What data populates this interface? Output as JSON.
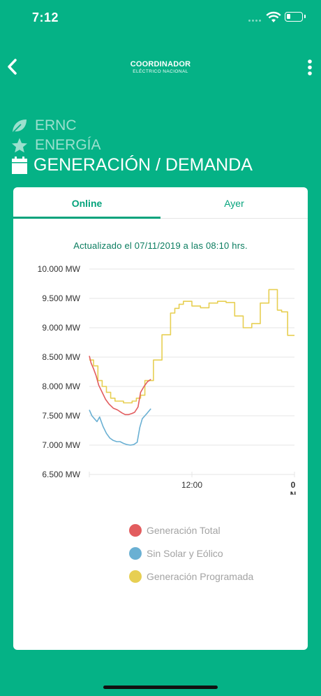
{
  "status_bar": {
    "time": "7:12"
  },
  "nav": {
    "logo_line1": "COORDINADOR",
    "logo_line2": "ELÉCTRICO NACIONAL"
  },
  "menu": [
    {
      "label": "ERNC",
      "icon": "leaf-icon"
    },
    {
      "label": "ENERGÍA",
      "icon": "star-icon"
    },
    {
      "label": "GENERACIÓN / DEMANDA",
      "icon": "calendar-icon"
    }
  ],
  "tabs": [
    {
      "label": "Online",
      "active": true
    },
    {
      "label": "Ayer",
      "active": false
    }
  ],
  "updated_text": "Actualizado el 07/11/2019 a las 08:10 hrs.",
  "colors": {
    "background": "#05b286",
    "accent": "#05a37c"
  },
  "chart_data": {
    "type": "line",
    "ylim": [
      6500,
      10000
    ],
    "y_ticks": [
      10000,
      9500,
      9000,
      8500,
      8000,
      7500,
      7000,
      6500
    ],
    "y_tick_labels": [
      "10.000 MW",
      "9.500 MW",
      "9.000 MW",
      "8.500 MW",
      "8.000 MW",
      "7.500 MW",
      "7.000 MW",
      "6.500 MW"
    ],
    "x_ticks": [
      {
        "hour": 12,
        "label": "12:00"
      },
      {
        "hour": 24,
        "label": "0"
      }
    ],
    "x_edge_label": "N",
    "xlim": [
      0,
      24
    ],
    "series": [
      {
        "name": "Generación Total",
        "color": "#e25c5e",
        "x": [
          0,
          0.2,
          0.5,
          0.8,
          1.1,
          1.5,
          1.9,
          2.3,
          2.8,
          3.3,
          3.8,
          4.2,
          4.6,
          5.0,
          5.3,
          5.7,
          6.0,
          6.4,
          6.8,
          7.2
        ],
        "y": [
          8520,
          8400,
          8300,
          8180,
          8020,
          7900,
          7780,
          7700,
          7630,
          7600,
          7550,
          7520,
          7520,
          7540,
          7560,
          7650,
          7900,
          8000,
          8080,
          8120
        ]
      },
      {
        "name": "Sin Solar y Eólico",
        "color": "#6ab0d3",
        "x": [
          0,
          0.3,
          0.6,
          0.9,
          1.2,
          1.6,
          2.0,
          2.4,
          2.8,
          3.2,
          3.6,
          4.0,
          4.4,
          4.8,
          5.2,
          5.6,
          5.9,
          6.2,
          6.5,
          6.8,
          7.2
        ],
        "y": [
          7600,
          7500,
          7450,
          7400,
          7480,
          7320,
          7200,
          7120,
          7080,
          7060,
          7060,
          7030,
          7010,
          7000,
          7010,
          7050,
          7300,
          7450,
          7500,
          7550,
          7620
        ]
      },
      {
        "name": "Generación Programada",
        "color": "#e7cf52",
        "x": [
          0,
          0.5,
          0.5,
          1.0,
          1.0,
          1.5,
          1.5,
          2.0,
          2.0,
          2.5,
          2.5,
          3.0,
          3.0,
          3.5,
          3.5,
          4.0,
          4.0,
          5.0,
          5.0,
          5.5,
          5.5,
          6.0,
          6.0,
          6.5,
          6.5,
          7.0,
          7.0,
          7.5,
          7.5,
          8.0,
          8.0,
          8.5,
          8.5,
          9.0,
          9.0,
          9.5,
          9.5,
          10.0,
          10.0,
          10.5,
          10.5,
          11.0,
          11.0,
          11.5,
          11.5,
          12.0,
          12.0,
          13.0,
          13.0,
          14.0,
          14.0,
          15.0,
          15.0,
          16.0,
          16.0,
          17.0,
          17.0,
          18.0,
          18.0,
          19.0,
          19.0,
          20.0,
          20.0,
          21.0,
          21.0,
          22.0,
          22.0,
          22.5,
          22.5,
          23.2,
          23.2,
          24.0
        ],
        "y": [
          8450,
          8450,
          8350,
          8350,
          8100,
          8100,
          8000,
          8000,
          7900,
          7900,
          7800,
          7800,
          7750,
          7750,
          7750,
          7750,
          7720,
          7720,
          7750,
          7750,
          7800,
          7800,
          7850,
          7850,
          8100,
          8100,
          8100,
          8100,
          8450,
          8450,
          8450,
          8450,
          8880,
          8880,
          8880,
          8880,
          9250,
          9250,
          9330,
          9330,
          9400,
          9400,
          9450,
          9450,
          9450,
          9450,
          9370,
          9370,
          9340,
          9340,
          9420,
          9420,
          9450,
          9450,
          9430,
          9430,
          9200,
          9200,
          9000,
          9000,
          9070,
          9070,
          9420,
          9420,
          9650,
          9650,
          9300,
          9300,
          9270,
          9270,
          8870,
          8870
        ]
      }
    ]
  }
}
